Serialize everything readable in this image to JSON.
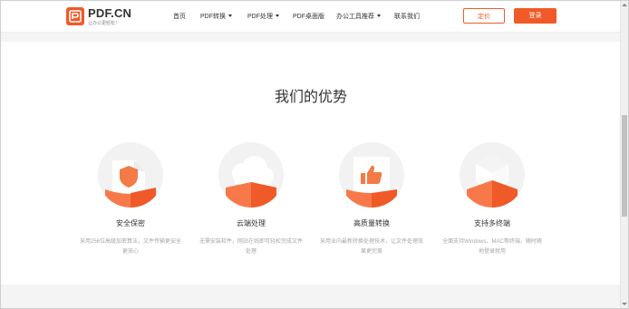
{
  "brand": {
    "name": "PDF.CN",
    "slogan": "让办公更轻松！",
    "color": "#f05a28"
  },
  "nav": {
    "items": [
      {
        "label": "首页",
        "dropdown": false
      },
      {
        "label": "PDF转换",
        "dropdown": true
      },
      {
        "label": "PDF处理",
        "dropdown": true
      },
      {
        "label": "PDF桌面版",
        "dropdown": false
      },
      {
        "label": "办公工具推荐",
        "dropdown": true
      },
      {
        "label": "联系我们",
        "dropdown": false
      }
    ]
  },
  "header_buttons": {
    "pricing_label": "定价",
    "login_label": "登录"
  },
  "advantages": {
    "title": "我们的优势",
    "features": [
      {
        "name": "安全保密",
        "icon": "shield-document-icon",
        "desc": "采用256位高级加密算法，文件传输更安全更放心"
      },
      {
        "name": "云端处理",
        "icon": "cloud-icon",
        "desc": "无需安装软件，网站在线即可轻松完成文件处理"
      },
      {
        "name": "高质量转换",
        "icon": "thumbs-up-icon",
        "desc": "采用业内最新转换处理技术，让文件处理效果更完美"
      },
      {
        "name": "支持多终端",
        "icon": "multi-device-icon",
        "desc": "全面支持Windows、MAC等终端，随时随地登录就用"
      }
    ]
  }
}
